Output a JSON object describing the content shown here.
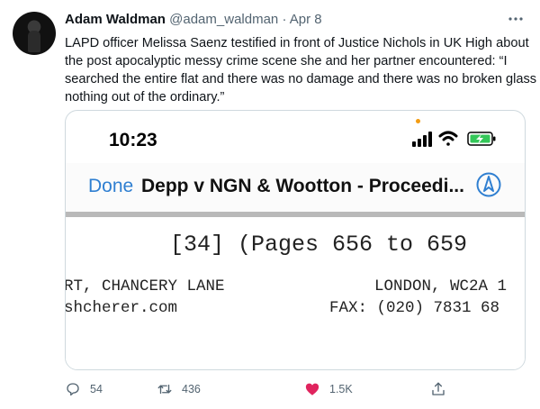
{
  "tweet": {
    "author_name": "Adam Waldman",
    "handle": "@adam_waldman",
    "separator": "·",
    "date": "Apr 8",
    "text_lines": [
      "LAPD officer Melissa Saenz testified in front of Justice Nichols in UK High about",
      "the post apocalyptic messy crime scene she and her partner encountered: “I",
      "searched the entire flat and there was no damage and there was no broken glass ...",
      "nothing out of the ordinary.”"
    ]
  },
  "embedded_screenshot": {
    "status_time": "10:23",
    "done_label": "Done",
    "nav_title": "Depp v NGN & Wootton - Proceedi...",
    "doc_lines": {
      "pages": "[34] (Pages 656 to 659",
      "address_left": "RT, CHANCERY LANE",
      "address_right": "LONDON, WC2A 1",
      "web_left": "shcherer.com",
      "fax_right": "FAX: (020) 7831 68"
    },
    "colors": {
      "done": "#2f7fd1",
      "battery": "#34c759",
      "dot": "#f39c12"
    }
  },
  "actions": {
    "replies": "54",
    "retweets": "436",
    "likes": "1.5K",
    "like_color": "#e0245e"
  },
  "icons": [
    "more-icon",
    "reply-icon",
    "retweet-icon",
    "heart-icon",
    "share-icon",
    "signal-icon",
    "wifi-icon",
    "battery-icon",
    "compass-icon"
  ]
}
